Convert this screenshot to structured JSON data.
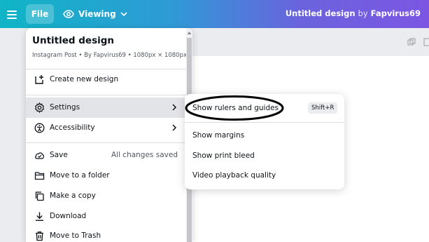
{
  "topbar": {
    "file_label": "File",
    "viewing_label": "Viewing",
    "design_title": "Untitled design",
    "by_label": "by",
    "username": "Fapvirus69"
  },
  "file_menu": {
    "title": "Untitled design",
    "subtitle": "Instagram Post • By Fapvirus69 • 1080px × 1080px",
    "items": [
      {
        "label": "Create new design",
        "icon": "add-design-icon"
      },
      {
        "label": "Settings",
        "icon": "gear-icon"
      },
      {
        "label": "Accessibility",
        "icon": "accessibility-icon"
      },
      {
        "label": "Save",
        "icon": "cloud-check-icon",
        "status": "All changes saved"
      },
      {
        "label": "Move to a folder",
        "icon": "folder-icon"
      },
      {
        "label": "Make a copy",
        "icon": "copy-icon"
      },
      {
        "label": "Download",
        "icon": "download-icon"
      },
      {
        "label": "Move to Trash",
        "icon": "trash-icon"
      }
    ]
  },
  "settings_submenu": {
    "items": [
      {
        "label": "Show rulers and guides",
        "shortcut": "Shift+R"
      },
      {
        "label": "Show margins"
      },
      {
        "label": "Show print bleed"
      },
      {
        "label": "Video playback quality"
      }
    ]
  },
  "colors": {
    "accent_gradient_start": "#10b5c6",
    "accent_gradient_end": "#7c56e3",
    "annotation_ellipse": "#000000"
  }
}
